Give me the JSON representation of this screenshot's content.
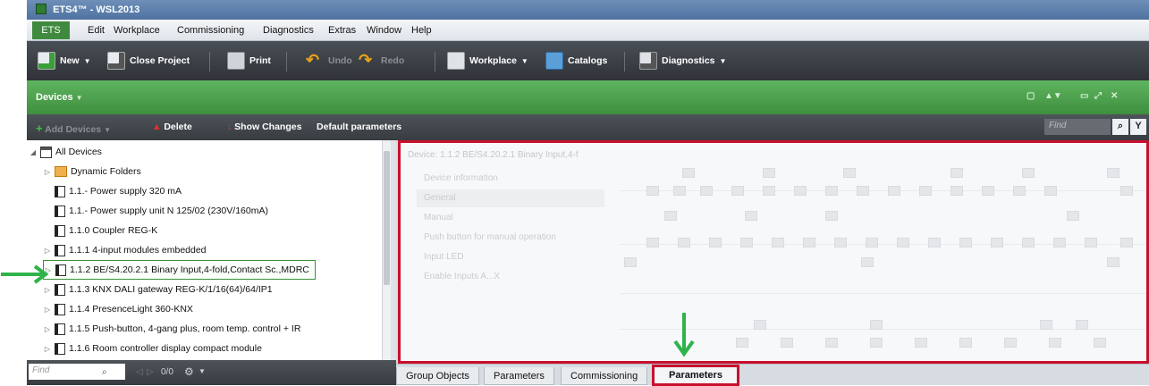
{
  "window": {
    "title": "ETS4™ - WSL2013"
  },
  "menubar": {
    "ets_button": "ETS",
    "items": [
      "Edit",
      "Workplace",
      "Commissioning",
      "Diagnostics",
      "Extras",
      "Window",
      "Help"
    ]
  },
  "toolbar": {
    "new": "New",
    "close_project": "Close Project",
    "print": "Print",
    "undo": "Undo",
    "redo": "Redo",
    "workplace": "Workplace",
    "catalogs": "Catalogs",
    "diagnostics": "Diagnostics"
  },
  "devices_panel": {
    "title": "Devices",
    "add_devices": "Add Devices",
    "delete": "Delete",
    "show_changes": "Show Changes",
    "default_parameters": "Default parameters",
    "search_placeholder": "Find"
  },
  "tree": {
    "root": "All Devices",
    "folders": "Dynamic Folders",
    "items": [
      "1.1.- Power supply 320 mA",
      "1.1.- Power supply unit N 125/02 (230V/160mA)",
      "1.1.0 Coupler REG-K",
      "1.1.1 4-input modules embedded",
      "1.1.2 BE/S4.20.2.1 Binary Input,4-fold,Contact Sc.,MDRC",
      "1.1.3 KNX DALI gateway REG-K/1/16(64)/64/IP1",
      "1.1.4 PresenceLight 360-KNX",
      "1.1.5 Push-button, 4-gang plus, room temp. control + IR",
      "1.1.6 Room controller display compact module"
    ]
  },
  "tree_footer": {
    "find_placeholder": "Find",
    "counter": "0/0"
  },
  "detail_panel": {
    "device_label": "Device: 1.1.2 BE/S4.20.2.1 Binary Input,4-f",
    "menu": [
      "Device information",
      "General",
      "Manual",
      "Push button for manual operation",
      "Input LED",
      "Enable Inputs A...X"
    ]
  },
  "tabs": [
    "Group Objects",
    "Parameters",
    "Commissioning",
    "Parameters"
  ],
  "colors": {
    "accent_green": "#3e8f3e",
    "highlight_red": "#c8102e",
    "arrow_green": "#2db34a"
  },
  "icons": [
    "new-icon",
    "close-project-icon",
    "print-icon",
    "undo-icon",
    "redo-icon",
    "workplace-icon",
    "catalogs-icon",
    "diagnostics-icon",
    "add-icon",
    "delete-icon",
    "show-changes-icon",
    "search-icon",
    "filter-icon",
    "settings-icon"
  ]
}
